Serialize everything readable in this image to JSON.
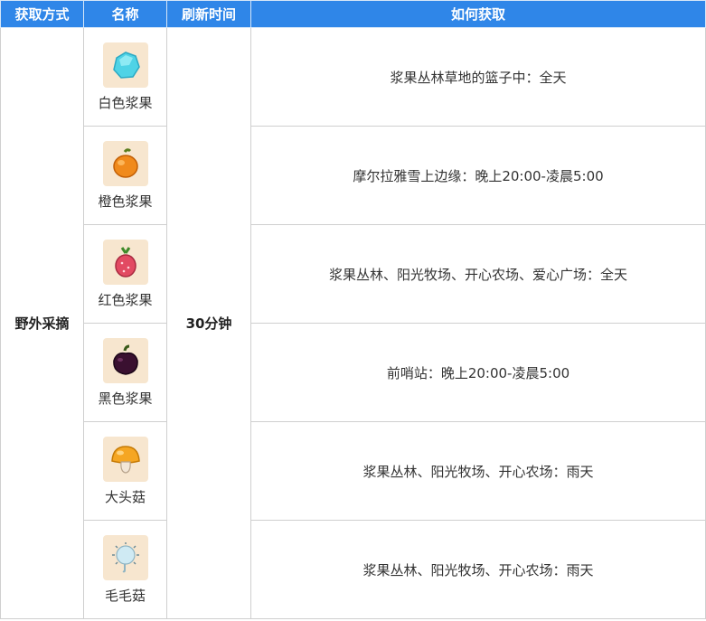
{
  "header": {
    "method": "获取方式",
    "name": "名称",
    "refresh": "刷新时间",
    "how": "如何获取"
  },
  "method_value": "野外采摘",
  "refresh_value": "30分钟",
  "rows": [
    {
      "name": "白色浆果",
      "icon": "white-berry-icon",
      "how": "浆果丛林草地的篮子中：全天"
    },
    {
      "name": "橙色浆果",
      "icon": "orange-berry-icon",
      "how": "摩尔拉雅雪上边缘：晚上20:00-凌晨5:00"
    },
    {
      "name": "红色浆果",
      "icon": "red-berry-icon",
      "how": "浆果丛林、阳光牧场、开心农场、爱心广场：全天"
    },
    {
      "name": "黑色浆果",
      "icon": "black-berry-icon",
      "how": "前哨站：晚上20:00-凌晨5:00"
    },
    {
      "name": "大头菇",
      "icon": "big-head-mushroom-icon",
      "how": "浆果丛林、阳光牧场、开心农场：雨天"
    },
    {
      "name": "毛毛菇",
      "icon": "fuzzy-mushroom-icon",
      "how": "浆果丛林、阳光牧场、开心农场：雨天"
    }
  ]
}
